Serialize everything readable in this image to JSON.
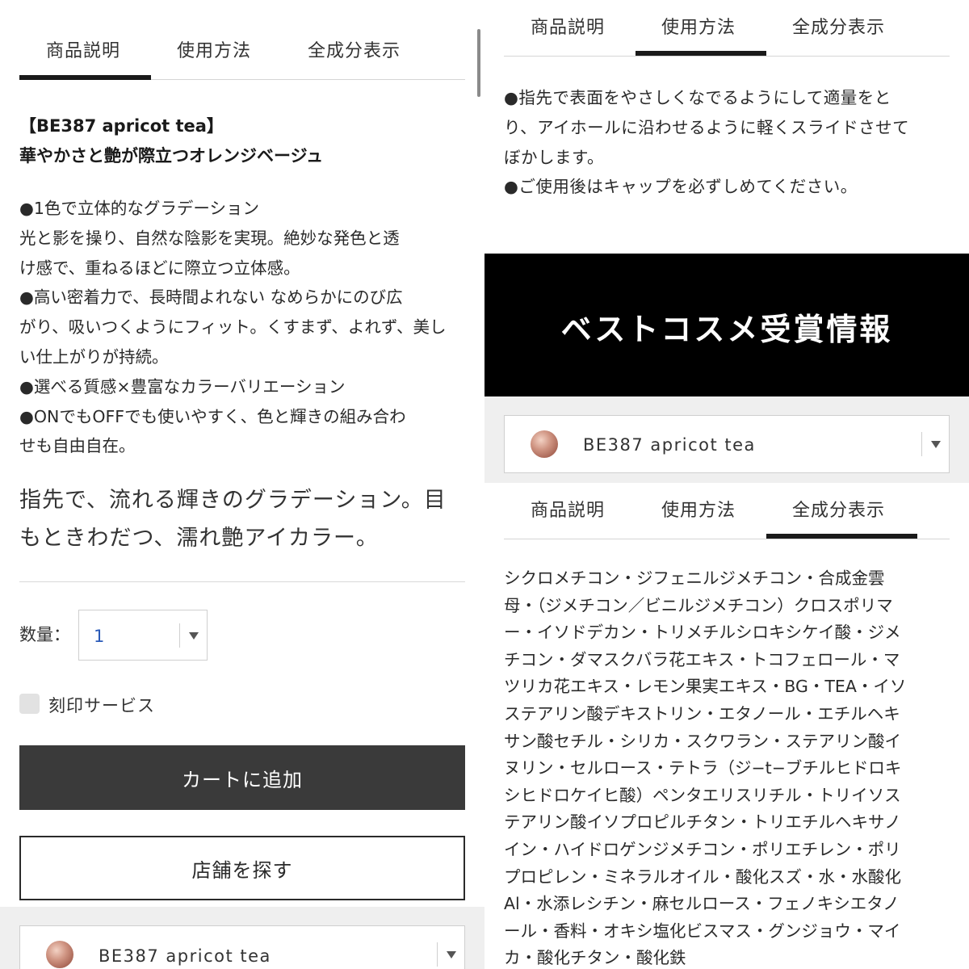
{
  "left": {
    "tabs": [
      "商品説明",
      "使用方法",
      "全成分表示"
    ],
    "active_tab": "商品説明",
    "heading": [
      "【BE387 apricot tea】",
      "華やかさと艶が際立つオレンジベージュ"
    ],
    "description": [
      "●1色で立体的なグラデーション",
      "光と影を操り、自然な陰影を実現。絶妙な発色と透",
      "け感で、重ねるほどに際立つ立体感。",
      "●高い密着力で、長時間よれない なめらかにのび広",
      "がり、吸いつくようにフィット。くすまず、よれず、美し",
      "い仕上がりが持続。",
      "●選べる質感×豊富なカラーバリエーション",
      "●ONでもOFFでも使いやすく、色と輝きの組み合わ",
      "せも自由自在。"
    ],
    "tagline": [
      "指先で、流れる輝きのグラデーション。目",
      "もときわだつ、濡れ艶アイカラー。"
    ],
    "quantity": {
      "label": "数量：",
      "value": "1"
    },
    "engraving": {
      "label": "刻印サービス",
      "checked": false
    },
    "add_to_cart": "カートに追加",
    "find_store": "店舗を探す",
    "shade_select": {
      "name": "BE387 apricot tea",
      "swatch_color": "#c48878"
    }
  },
  "right": {
    "top_tabs": [
      "商品説明",
      "使用方法",
      "全成分表示"
    ],
    "top_active_tab": "使用方法",
    "usage": [
      "●指先で表面をやさしくなでるようにして適量をと",
      "り、アイホールに沿わせるように軽くスライドさせて",
      "ぼかします。",
      "●ご使用後はキャップを必ずしめてください。"
    ],
    "banner": "ベストコスメ受賞情報",
    "shade_select": {
      "name": "BE387 apricot tea",
      "swatch_color": "#c48878"
    },
    "bottom_tabs": [
      "商品説明",
      "使用方法",
      "全成分表示"
    ],
    "bottom_active_tab": "全成分表示",
    "ingredients": [
      "シクロメチコン・ジフェニルジメチコン・合成金雲",
      "母・（ジメチコン／ビニルジメチコン）クロスポリマ",
      "ー・イソドデカン・トリメチルシロキシケイ酸・ジメ",
      "チコン・ダマスクバラ花エキス・トコフェロール・マ",
      "ツリカ花エキス・レモン果実エキス・BG・TEA・イソ",
      "ステアリン酸デキストリン・エタノール・エチルヘキ",
      "サン酸セチル・シリカ・スクワラン・ステアリン酸イ",
      "ヌリン・セルロース・テトラ（ジ−t−ブチルヒドロキ",
      "シヒドロケイヒ酸）ペンタエリスリチル・トリイソス",
      "テアリン酸イソプロピルチタン・トリエチルヘキサノ",
      "イン・ハイドロゲンジメチコン・ポリエチレン・ポリ",
      "プロピレン・ミネラルオイル・酸化スズ・水・水酸化",
      "Al・水添レシチン・麻セルロース・フェノキシエタノ",
      "ール・香料・オキシ塩化ビスマス・グンジョウ・マイ",
      "カ・酸化チタン・酸化鉄"
    ]
  },
  "colors": {
    "text": "#2a2a2a",
    "cart_button": "#3a3a3a",
    "banner": "#000000",
    "quantity_value": "#2a5ab8"
  }
}
